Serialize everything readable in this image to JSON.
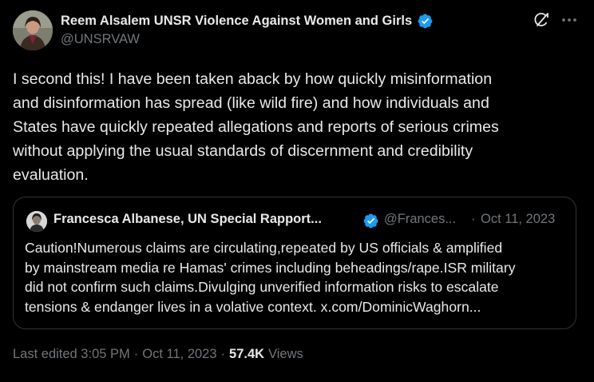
{
  "author": {
    "name": "Reem Alsalem UNSR Violence Against Women and Girls",
    "handle": "@UNSRVAW",
    "verified": true
  },
  "tweet_text": "I second this! I have been taken aback by how quickly misinformation\nand disinformation has spread (like wild fire) and how individuals and\nStates have quickly repeated allegations and reports of serious crimes\nwithout applying the usual standards of discernment and credibility\nevaluation.",
  "quoted": {
    "name": "Francesca Albanese, UN Special Rapport...",
    "handle": "@Frances...",
    "separator": "·",
    "date": "Oct 11, 2023",
    "verified": true,
    "text": "Caution!Numerous claims are circulating,repeated by US officials & amplified\nby mainstream media re Hamas' crimes including beheadings/rape.ISR military\ndid not confirm such claims.Divulging unverified information risks to escalate\ntensions & endanger lives in a volative context. x.com/DominicWaghorn..."
  },
  "footer": {
    "edited": "Last edited 3:05 PM",
    "separator": "·",
    "date": "Oct 11, 2023",
    "views_count": "57.4K",
    "views_label": "Views"
  },
  "colors": {
    "background": "#000000",
    "text": "#e7e9ea",
    "muted": "#71767b",
    "verified": "#1d9bf0",
    "border": "#2f3336"
  },
  "icons": {
    "verified": "verified-badge-icon",
    "grok": "grok-icon",
    "more": "more-horizontal-icon"
  }
}
